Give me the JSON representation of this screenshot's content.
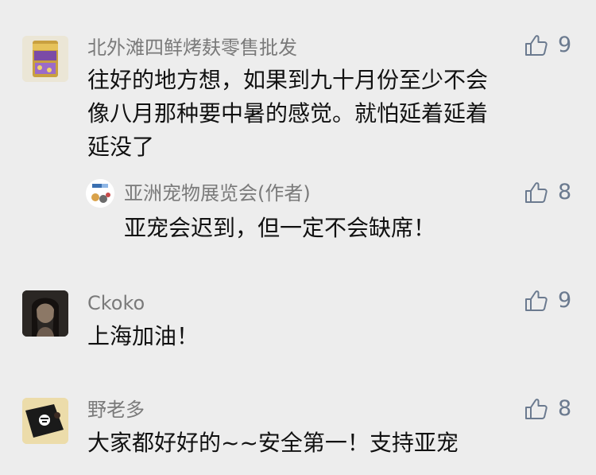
{
  "comments": [
    {
      "author": "北外滩四鲜烤麸零售批发",
      "likes": "9",
      "lines": [
        "往好的地方想，如果到九十月份至少不会",
        "像八月那种要中暑的感觉。就怕延着延着",
        "延没了"
      ],
      "reply": {
        "author": "亚洲宠物展览会(作者)",
        "likes": "8",
        "text": "亚宠会迟到，但一定不会缺席！"
      }
    },
    {
      "author": "Ckoko",
      "likes": "9",
      "lines": [
        "上海加油！"
      ]
    },
    {
      "author": "野老多",
      "likes": "8",
      "lines": [
        "大家都好好的~~安全第一！支持亚宠"
      ]
    }
  ],
  "icons": {
    "like": "thumbs-up-icon"
  },
  "colors": {
    "background": "#ededed",
    "name": "#7a7a7a",
    "text": "#111111",
    "like": "#6b7a8f"
  }
}
